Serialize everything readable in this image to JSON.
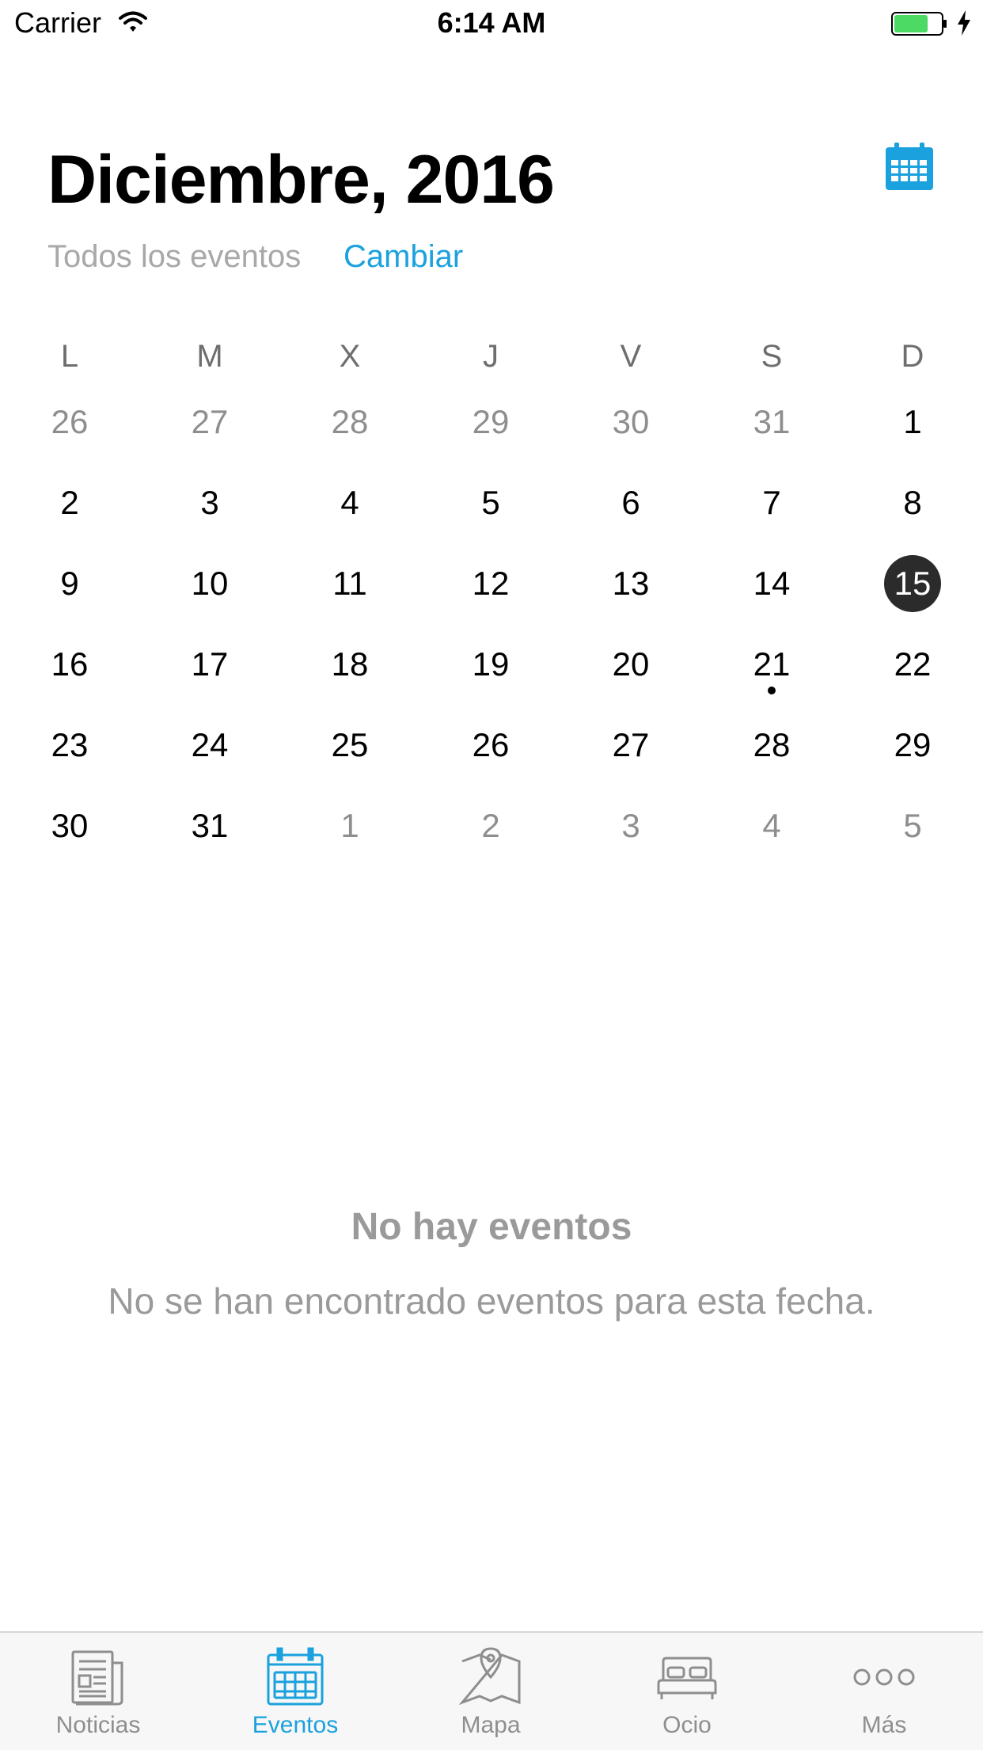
{
  "status_bar": {
    "carrier": "Carrier",
    "time": "6:14 AM"
  },
  "header": {
    "title": "Diciembre, 2016",
    "filter_label": "Todos los eventos",
    "change_label": "Cambiar",
    "calendar_icon": "calendar-icon"
  },
  "calendar": {
    "weekdays": [
      "L",
      "M",
      "X",
      "J",
      "V",
      "S",
      "D"
    ],
    "weeks": [
      [
        {
          "d": "26",
          "m": true
        },
        {
          "d": "27",
          "m": true
        },
        {
          "d": "28",
          "m": true
        },
        {
          "d": "29",
          "m": true
        },
        {
          "d": "30",
          "m": true
        },
        {
          "d": "31",
          "m": true
        },
        {
          "d": "1"
        }
      ],
      [
        {
          "d": "2"
        },
        {
          "d": "3"
        },
        {
          "d": "4"
        },
        {
          "d": "5"
        },
        {
          "d": "6"
        },
        {
          "d": "7"
        },
        {
          "d": "8"
        }
      ],
      [
        {
          "d": "9"
        },
        {
          "d": "10"
        },
        {
          "d": "11"
        },
        {
          "d": "12"
        },
        {
          "d": "13"
        },
        {
          "d": "14"
        },
        {
          "d": "15",
          "selected": true
        }
      ],
      [
        {
          "d": "16"
        },
        {
          "d": "17"
        },
        {
          "d": "18"
        },
        {
          "d": "19"
        },
        {
          "d": "20"
        },
        {
          "d": "21",
          "event": true
        },
        {
          "d": "22"
        }
      ],
      [
        {
          "d": "23"
        },
        {
          "d": "24"
        },
        {
          "d": "25"
        },
        {
          "d": "26"
        },
        {
          "d": "27"
        },
        {
          "d": "28"
        },
        {
          "d": "29"
        }
      ],
      [
        {
          "d": "30"
        },
        {
          "d": "31"
        },
        {
          "d": "1",
          "m": true
        },
        {
          "d": "2",
          "m": true
        },
        {
          "d": "3",
          "m": true
        },
        {
          "d": "4",
          "m": true
        },
        {
          "d": "5",
          "m": true
        }
      ]
    ],
    "selected_color": "#2b2b2b"
  },
  "empty_state": {
    "title": "No hay eventos",
    "message": "No se han encontrado eventos para esta fecha."
  },
  "tab_bar": {
    "tabs": [
      {
        "label": "Noticias",
        "icon": "newspaper-icon",
        "active": false
      },
      {
        "label": "Eventos",
        "icon": "calendar-icon",
        "active": true
      },
      {
        "label": "Mapa",
        "icon": "map-icon",
        "active": false
      },
      {
        "label": "Ocio",
        "icon": "bed-icon",
        "active": false
      },
      {
        "label": "Más",
        "icon": "more-icon",
        "active": false
      }
    ]
  },
  "colors": {
    "accent": "#1aa1de",
    "muted_text": "#a8a8a8",
    "battery_green": "#4cd964"
  }
}
